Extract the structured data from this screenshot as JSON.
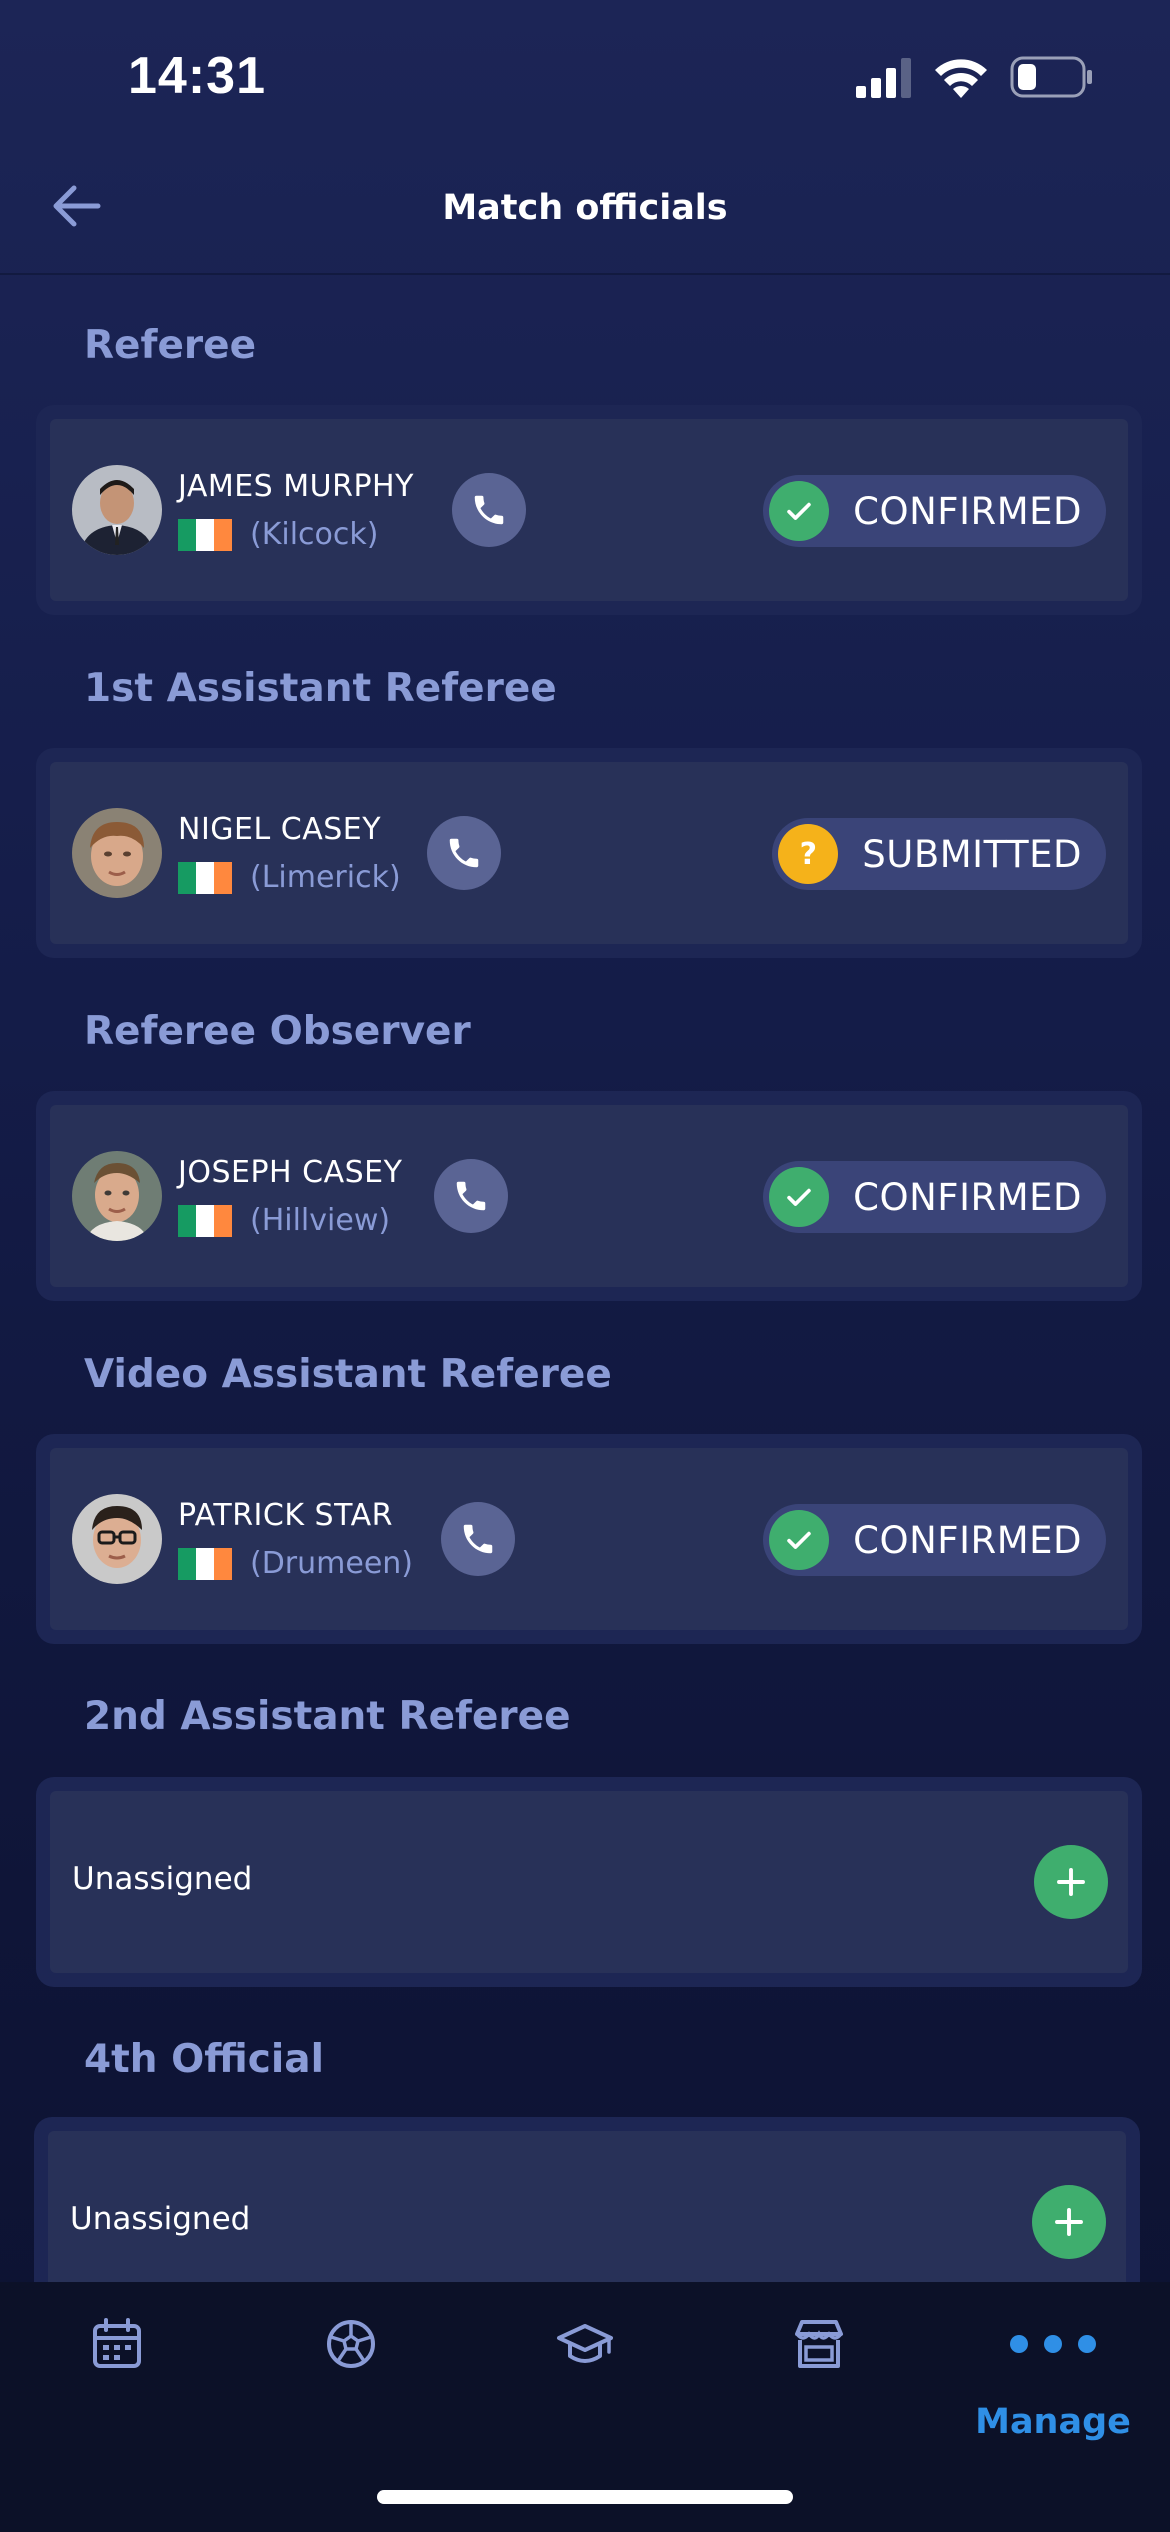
{
  "status_bar": {
    "time": "14:31"
  },
  "header": {
    "title": "Match officials"
  },
  "sections": [
    {
      "title": "Referee",
      "official": {
        "name": "JAMES MURPHY",
        "location": "(Kilcock)"
      },
      "status": {
        "label": "CONFIRMED",
        "icon": "check-icon"
      }
    },
    {
      "title": "1st Assistant Referee",
      "official": {
        "name": "NIGEL CASEY",
        "location": "(Limerick)"
      },
      "status": {
        "label": "SUBMITTED",
        "icon": "question-icon"
      }
    },
    {
      "title": "Referee Observer",
      "official": {
        "name": "JOSEPH CASEY",
        "location": "(Hillview)"
      },
      "status": {
        "label": "CONFIRMED",
        "icon": "check-icon"
      }
    },
    {
      "title": "Video Assistant Referee",
      "official": {
        "name": "PATRICK STAR",
        "location": "(Drumeen)"
      },
      "status": {
        "label": "CONFIRMED",
        "icon": "check-icon"
      }
    },
    {
      "title": "2nd Assistant Referee",
      "unassigned_label": "Unassigned"
    },
    {
      "title": "4th Official",
      "unassigned_label": "Unassigned"
    }
  ],
  "tab_bar": {
    "tabs": [
      {
        "icon": "calendar-icon",
        "label": ""
      },
      {
        "icon": "football-icon",
        "label": ""
      },
      {
        "icon": "graduation-cap-icon",
        "label": ""
      },
      {
        "icon": "store-icon",
        "label": ""
      },
      {
        "icon": "more-dots-icon",
        "label": "Manage",
        "active": true
      }
    ]
  },
  "colors": {
    "background": "#141d45",
    "card": "#283158",
    "section_title": "#8a9bd6",
    "confirmed_green": "#3fae6e",
    "submitted_yellow": "#f5b21a",
    "active_tab": "#2f8fe6",
    "flag": [
      "#169b62",
      "#ffffff",
      "#ff883e"
    ]
  }
}
